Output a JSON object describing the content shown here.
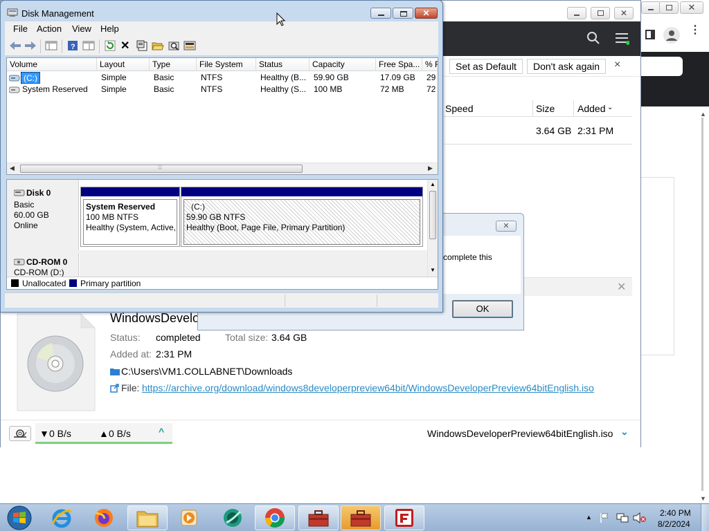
{
  "browser": {
    "win_controls": [
      "minimize-icon",
      "restore-icon",
      "close-icon"
    ]
  },
  "downloads": {
    "infobar": {
      "set_default": "Set as Default",
      "dont_ask": "Don't ask again",
      "close": "×"
    },
    "columns": {
      "speed": "Speed",
      "size": "Size",
      "added": "Added"
    },
    "row": {
      "size": "3.64 GB",
      "added": "2:31 PM"
    },
    "details": {
      "title": "WindowsDevelo",
      "status_label": "Status:",
      "status_value": "completed",
      "total_label": "Total size:",
      "total_value": "3.64 GB",
      "added_label": "Added at:",
      "added_value": "2:31 PM",
      "folder": "C:\\Users\\VM1.COLLABNET\\Downloads",
      "file_label": "File:",
      "file_url": "https://archive.org/download/windows8developerpreview64bit/WindowsDeveloperPreview64bitEnglish.iso"
    },
    "status": {
      "down": "0 B/s",
      "up": "0 B/s",
      "filename": "WindowsDeveloperPreview64bitEnglish.iso"
    }
  },
  "dialog": {
    "message": "complete this",
    "ok": "OK"
  },
  "disk_mgmt": {
    "title": "Disk Management",
    "menu": [
      "File",
      "Action",
      "View",
      "Help"
    ],
    "columns": [
      "Volume",
      "Layout",
      "Type",
      "File System",
      "Status",
      "Capacity",
      "Free Spa...",
      "% F"
    ],
    "volumes": [
      [
        "(C:)",
        "Simple",
        "Basic",
        "NTFS",
        "Healthy (B...",
        "59.90 GB",
        "17.09 GB",
        "29"
      ],
      [
        "System Reserved",
        "Simple",
        "Basic",
        "NTFS",
        "Healthy (S...",
        "100 MB",
        "72 MB",
        "72"
      ]
    ],
    "disk0": {
      "name": "Disk 0",
      "type": "Basic",
      "size": "60.00 GB",
      "state": "Online"
    },
    "part_reserved": {
      "name": "System Reserved",
      "fs": "100 MB NTFS",
      "status": "Healthy (System, Active,"
    },
    "part_c": {
      "name": "(C:)",
      "fs": "59.90 GB NTFS",
      "status": "Healthy (Boot, Page File, Primary Partition)"
    },
    "cdrom": {
      "name": "CD-ROM 0",
      "drive": "CD-ROM (D:)"
    },
    "legend": {
      "unallocated": "Unallocated",
      "primary": "Primary partition"
    },
    "colors": {
      "unallocated": "#000000",
      "primary": "#000080"
    }
  },
  "taskbar": {
    "time": "2:40 PM",
    "date": "8/2/2024",
    "apps": [
      "internet-explorer",
      "firefox",
      "file-explorer",
      "media-player",
      "app-green",
      "chrome",
      "toolbox",
      "toolbox",
      "app-filezilla"
    ]
  }
}
